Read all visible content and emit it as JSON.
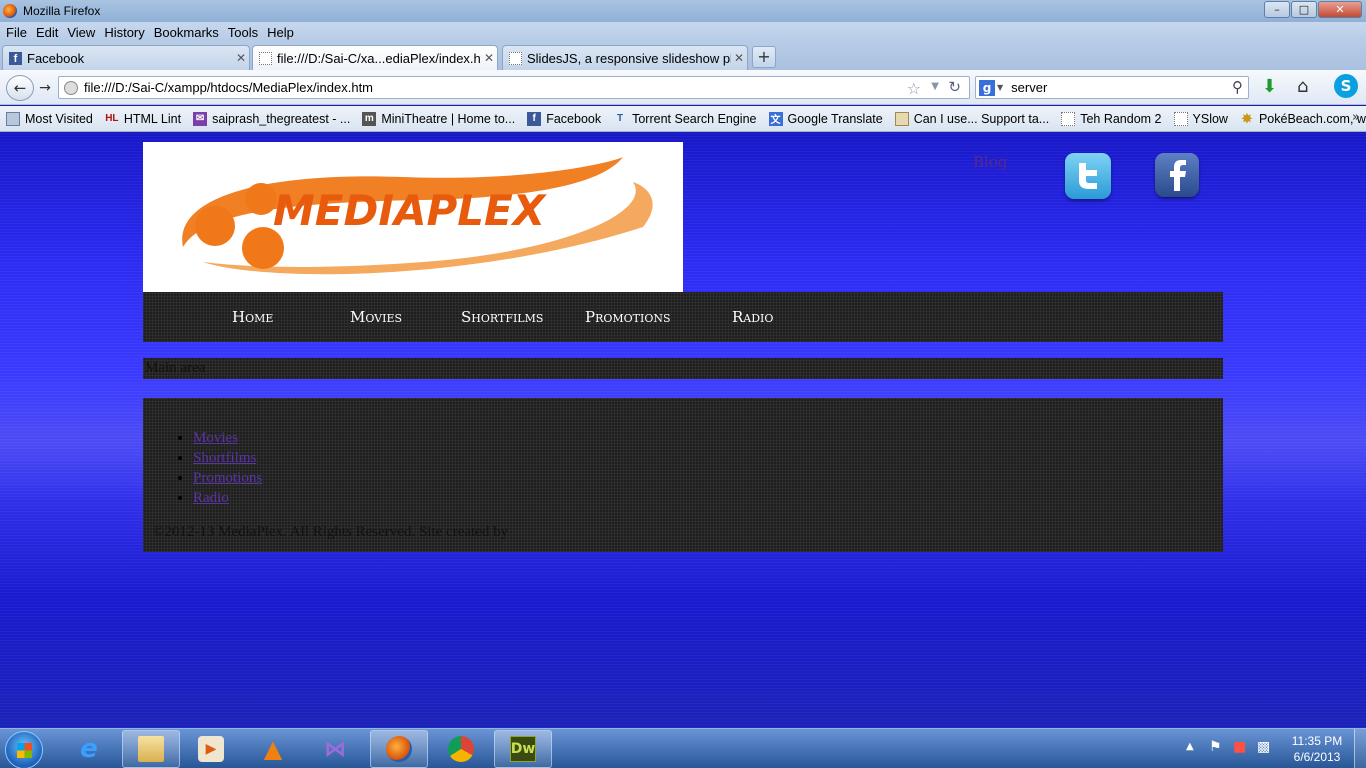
{
  "window": {
    "title": "Mozilla Firefox"
  },
  "menu": [
    "File",
    "Edit",
    "View",
    "History",
    "Bookmarks",
    "Tools",
    "Help"
  ],
  "tabs": [
    {
      "label": "Facebook",
      "icon": "facebook-icon"
    },
    {
      "label": "file:///D:/Sai-C/xa...ediaPlex/index.htm",
      "icon": "blank-page-icon"
    },
    {
      "label": "SlidesJS, a responsive slideshow plug-...",
      "icon": "blank-page-icon"
    }
  ],
  "navbar": {
    "url": "file:///D:/Sai-C/xampp/htdocs/MediaPlex/index.htm",
    "search_value": "server"
  },
  "bookmarks": [
    {
      "label": "Most Visited",
      "icon": "most-visited-icon"
    },
    {
      "label": "HTML Lint",
      "icon": "htmllint-icon"
    },
    {
      "label": "saiprash_thegreatest - ...",
      "icon": "mail-icon"
    },
    {
      "label": "MiniTheatre | Home to...",
      "icon": "minitheatre-icon"
    },
    {
      "label": "Facebook",
      "icon": "facebook-icon"
    },
    {
      "label": "Torrent Search Engine",
      "icon": "torrent-icon"
    },
    {
      "label": "Google Translate",
      "icon": "translate-icon"
    },
    {
      "label": "Can I use... Support ta...",
      "icon": "caniuse-icon"
    },
    {
      "label": "Teh Random 2",
      "icon": "blank-page-icon"
    },
    {
      "label": "YSlow",
      "icon": "blank-page-icon"
    },
    {
      "label": "PokéBeach.com, with '...",
      "icon": "pokebeach-icon"
    }
  ],
  "site": {
    "logo_text": "MEDIAPLEX",
    "social_blog": "Blog",
    "nav": [
      "Home",
      "Movies",
      "Shortfilms",
      "Promotions",
      "Radio"
    ],
    "main_area": "Main area",
    "footer_links": [
      "Movies",
      "Shortfilms",
      "Promotions",
      "Radio"
    ],
    "copyright": "©2012-13 MediaPlex. All Rights Reserved. Site created by"
  },
  "taskbar": {
    "time": "11:35 PM",
    "date": "6/6/2013",
    "apps": [
      {
        "name": "internet-explorer-icon",
        "label": "e"
      },
      {
        "name": "file-explorer-icon",
        "label": ""
      },
      {
        "name": "media-player-icon",
        "label": ""
      },
      {
        "name": "vlc-icon",
        "label": ""
      },
      {
        "name": "visual-studio-icon",
        "label": ""
      },
      {
        "name": "firefox-icon",
        "label": ""
      },
      {
        "name": "chrome-icon",
        "label": ""
      },
      {
        "name": "dreamweaver-icon",
        "label": "Dw"
      }
    ]
  },
  "colors": {
    "page_blue": "#2a2af0",
    "panel_dark": "#1f1f1f",
    "link_purple": "#5b33a6",
    "logo_orange": "#f07818"
  }
}
